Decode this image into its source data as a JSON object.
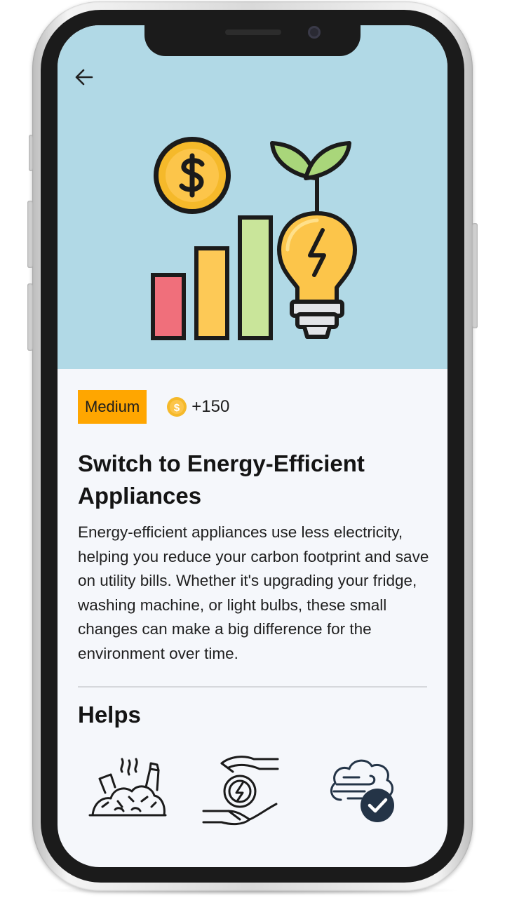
{
  "task": {
    "difficulty": "Medium",
    "reward": "+150",
    "title": "Switch to Energy-Efficient Appliances",
    "description": "Energy-efficient appliances use less electricity, helping you reduce your carbon footprint and save on utility bills. Whether it's upgrading your fridge, washing machine, or light bulbs, these small changes can make a big difference for the environment over time."
  },
  "helps": {
    "heading": "Helps",
    "icons": [
      "waste-pile-icon",
      "energy-saving-hands-icon",
      "clean-air-check-icon"
    ]
  },
  "icons": {
    "back": "arrow-left-icon",
    "hero": "energy-efficiency-illustration",
    "coin": "coin-icon"
  },
  "colors": {
    "hero_bg": "#b1d9e6",
    "badge_bg": "#ffa600",
    "coin": "#f5b92a",
    "bar_red": "#f06f7b",
    "bar_yellow": "#fdc956",
    "bar_green": "#c9e59a",
    "navy": "#243447"
  }
}
